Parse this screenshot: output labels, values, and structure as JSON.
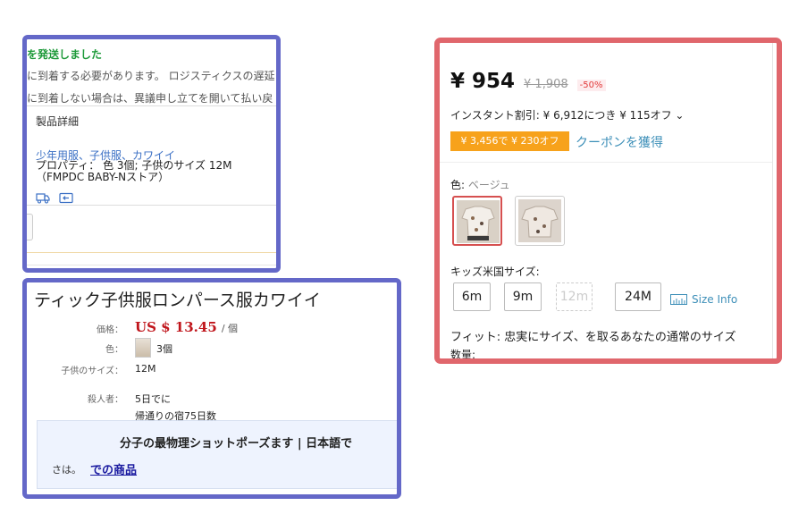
{
  "order_panel": {
    "shipped_text": "を発送しました",
    "note1": "に到着する必要があります。 ロジスティクスの遅延",
    "note2": "に到着しない場合は、異議申し立てを開いて払い戻",
    "detail_title": "製品詳細",
    "categories": "少年用服、子供服、カワイイ",
    "property_line1": "プロパティ： 色 3個; 子供のサイズ 12M",
    "property_line2": "（FMPDC BABY-Nストア）",
    "icons": [
      "truck-icon",
      "return-icon"
    ]
  },
  "product_panel": {
    "title": "ティック子供服ロンパース服カワイイ",
    "price_label": "価格：",
    "price_value": "US $ 13.45",
    "price_unit": "/ 個",
    "color_label": "色：",
    "color_value": "3個",
    "size_label": "子供のサイズ：",
    "size_value": "12M",
    "shipping_label": "殺人者：",
    "shipping_value1": "5日でに",
    "shipping_value2": "帰通りの宿75日数",
    "promo_heading": "分子の最物理ショットポーズます | 日本語で",
    "promo_text": "さは。",
    "promo_link": "での商品"
  },
  "price_panel": {
    "price": "¥ 954",
    "original_price": "¥ 1,908",
    "discount": "-50%",
    "instant_discount": "インスタント割引: ¥ 6,912につき ¥ 115オフ ⌄",
    "coupon_tag": "¥ 3,456で ¥ 230オフ",
    "coupon_get": "クーポンを獲得",
    "color_label": "色:",
    "color_value": "ベージュ",
    "size_label": "キッズ米国サイズ:",
    "sizes": [
      {
        "label": "6m",
        "available": true
      },
      {
        "label": "9m",
        "available": true
      },
      {
        "label": "12m",
        "available": false
      },
      {
        "label": "24M",
        "available": true
      }
    ],
    "size_info": "Size Info",
    "fit": "フィット: 忠実にサイズ、を取るあなたの通常のサイズ",
    "quantity_label": "数量:",
    "colors": {
      "discount_bg": "#fdecee",
      "coupon": "#f7a21b",
      "link": "#3d8fb8",
      "price_red": "#c0161c"
    }
  }
}
